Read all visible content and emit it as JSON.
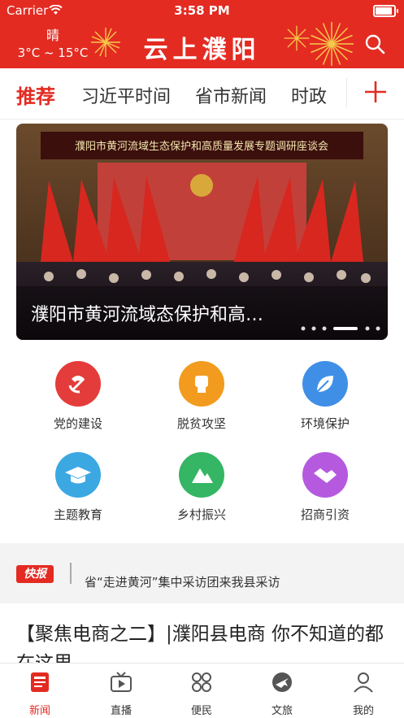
{
  "status": {
    "carrier": "Carrier",
    "time": "3:58 PM",
    "battery_level": 1.0
  },
  "header": {
    "weather_condition": "晴",
    "temperature": "3°C ~ 15°C",
    "brand": "云上濮阳",
    "search_icon": "search-icon",
    "accent": "#e32b22"
  },
  "tabs": [
    {
      "label": "推荐"
    },
    {
      "label": "习近平时间"
    },
    {
      "label": "省市新闻"
    },
    {
      "label": "时政"
    }
  ],
  "banner": {
    "backdrop_text": "濮阳市黄河流域生态保护和高质量发展专题调研座谈会",
    "caption": "濮阳市黄河流域态保护和高…",
    "slide_count": 6,
    "active_slide": 3
  },
  "categories": [
    {
      "label": "党的建设",
      "icon": "party-icon",
      "color": "#e43c3a"
    },
    {
      "label": "脱贫攻坚",
      "icon": "fist-icon",
      "color": "#f29b1f"
    },
    {
      "label": "环境保护",
      "icon": "leaf-icon",
      "color": "#3f8fe7"
    },
    {
      "label": "主题教育",
      "icon": "graduation-cap-icon",
      "color": "#3ba8e2"
    },
    {
      "label": "乡村振兴",
      "icon": "mountain-icon",
      "color": "#35b665"
    },
    {
      "label": "招商引资",
      "icon": "handshake-icon",
      "color": "#b55adf"
    }
  ],
  "news_flash": {
    "badge": "快报",
    "headline": "省“走进黄河”集中采访团来我县采访"
  },
  "article": {
    "title": "【聚焦电商之二】|濮阳县电商 你不知道的都在这里"
  },
  "tabbar": [
    {
      "label": "新闻",
      "icon": "news-icon",
      "active": true
    },
    {
      "label": "直播",
      "icon": "live-tv-icon",
      "active": false
    },
    {
      "label": "便民",
      "icon": "services-grid-icon",
      "active": false
    },
    {
      "label": "文旅",
      "icon": "travel-icon",
      "active": false
    },
    {
      "label": "我的",
      "icon": "profile-icon",
      "active": false
    }
  ]
}
